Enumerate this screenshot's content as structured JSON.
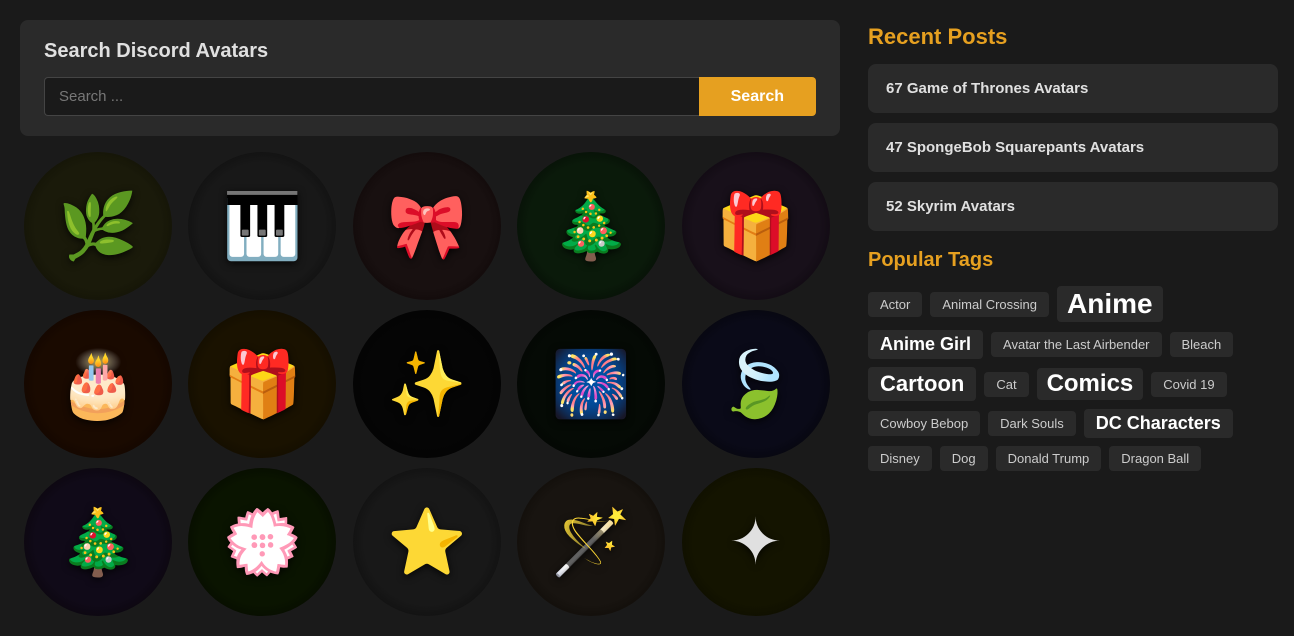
{
  "main": {
    "search_title": "Search Discord Avatars",
    "search_placeholder": "Search ...",
    "search_button": "Search"
  },
  "avatars": [
    {
      "id": 1,
      "emoji": "🌿",
      "class": "av1"
    },
    {
      "id": 2,
      "emoji": "🎹",
      "class": "av2"
    },
    {
      "id": 3,
      "emoji": "🎀",
      "class": "av3"
    },
    {
      "id": 4,
      "emoji": "🎄",
      "class": "av4"
    },
    {
      "id": 5,
      "emoji": "🎁",
      "class": "av5"
    },
    {
      "id": 6,
      "emoji": "🎂",
      "class": "av6"
    },
    {
      "id": 7,
      "emoji": "🎁",
      "class": "av7"
    },
    {
      "id": 8,
      "emoji": "✨",
      "class": "av8"
    },
    {
      "id": 9,
      "emoji": "🎆",
      "class": "av9"
    },
    {
      "id": 10,
      "emoji": "🍃",
      "class": "av10"
    },
    {
      "id": 11,
      "emoji": "🎄",
      "class": "av11"
    },
    {
      "id": 12,
      "emoji": "💮",
      "class": "av12"
    },
    {
      "id": 13,
      "emoji": "⭐",
      "class": "av13"
    },
    {
      "id": 14,
      "emoji": "🪄",
      "class": "av14"
    },
    {
      "id": 15,
      "emoji": "✦",
      "class": "av15"
    }
  ],
  "sidebar": {
    "recent_posts_title": "Recent Posts",
    "posts": [
      {
        "title": "67 Game of Thrones Avatars"
      },
      {
        "title": "47 SpongeBob Squarepants Avatars"
      },
      {
        "title": "52 Skyrim Avatars"
      }
    ],
    "popular_tags_title": "Popular Tags",
    "tags": [
      {
        "label": "Actor",
        "size": "sm"
      },
      {
        "label": "Animal Crossing",
        "size": "sm"
      },
      {
        "label": "Anime",
        "size": "xl"
      },
      {
        "label": "Anime Girl",
        "size": "md"
      },
      {
        "label": "Avatar the Last Airbender",
        "size": "sm"
      },
      {
        "label": "Bleach",
        "size": "sm"
      },
      {
        "label": "Cartoon",
        "size": "lg"
      },
      {
        "label": "Cat",
        "size": "sm"
      },
      {
        "label": "Comics",
        "size": "comics"
      },
      {
        "label": "Covid 19",
        "size": "sm"
      },
      {
        "label": "Cowboy Bebop",
        "size": "sm"
      },
      {
        "label": "Dark Souls",
        "size": "sm"
      },
      {
        "label": "DC Characters",
        "size": "md"
      },
      {
        "label": "Disney",
        "size": "sm"
      },
      {
        "label": "Dog",
        "size": "sm"
      },
      {
        "label": "Donald Trump",
        "size": "sm"
      },
      {
        "label": "Dragon Ball",
        "size": "sm"
      }
    ]
  }
}
